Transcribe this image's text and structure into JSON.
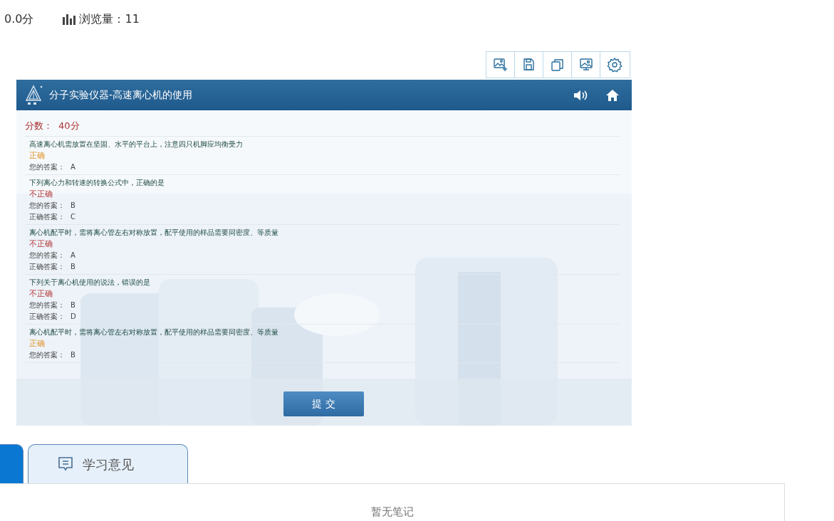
{
  "stats": {
    "score": "0.0分",
    "views": "浏览量：11"
  },
  "toolbar": {
    "buttons": [
      {
        "kind": "screenshot"
      },
      {
        "kind": "save"
      },
      {
        "kind": "copy"
      },
      {
        "kind": "screen"
      },
      {
        "kind": "settings"
      }
    ]
  },
  "simulation": {
    "title": "分子实验仪器-高速离心机的使用",
    "score_label": "分数：",
    "score": "40分",
    "questions": [
      {
        "text": "高速离心机需放置在坚固、水平的平台上，注意四只机脚应均衡受力",
        "correct": true,
        "status": "正确",
        "your_answer_label": "您的答案：",
        "your_answer": "A"
      },
      {
        "text": "下列离心力和转速的转换公式中，正确的是",
        "correct": false,
        "status": "不正确",
        "your_answer_label": "您的答案：",
        "your_answer": "B",
        "correct_answer_label": "正确答案：",
        "correct_answer": "C"
      },
      {
        "text": "离心机配平时，需将离心管左右对称放置，配平使用的样品需要同密度、等质量",
        "correct": false,
        "status": "不正确",
        "your_answer_label": "您的答案：",
        "your_answer": "A",
        "correct_answer_label": "正确答案：",
        "correct_answer": "B"
      },
      {
        "text": "下列关于离心机使用的说法，错误的是",
        "correct": false,
        "status": "不正确",
        "your_answer_label": "您的答案：",
        "your_answer": "B",
        "correct_answer_label": "正确答案：",
        "correct_answer": "D"
      },
      {
        "text": "离心机配平时，需将离心管左右对称放置，配平使用的样品需要同密度、等质量",
        "correct": true,
        "status": "正确",
        "your_answer_label": "您的答案：",
        "your_answer": "B"
      }
    ],
    "submit": "提 交"
  },
  "tabs": [
    {
      "selected": true
    },
    {
      "label": "学习意见",
      "selected": false
    }
  ],
  "notes": {
    "empty": "暂无笔记"
  }
}
